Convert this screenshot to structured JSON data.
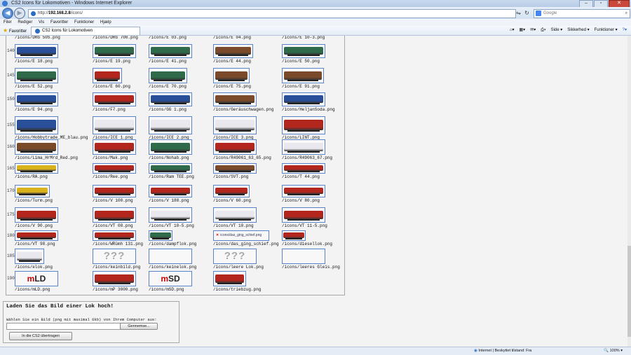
{
  "window": {
    "title": "CS2 Icons für Lokomotiven - Windows Internet Explorer"
  },
  "address": {
    "prefix": "http://",
    "host": "192.168.2.8",
    "path": "/icons/"
  },
  "search": {
    "placeholder": "Google"
  },
  "menu": [
    "Filer",
    "Rediger",
    "Vis",
    "Favoritter",
    "Funktioner",
    "Hjælp"
  ],
  "favorites": {
    "label": "Favoritter",
    "tab_title": "CS2 Icons für Lokomotiven"
  },
  "commandbar": {
    "page": "Side ▾",
    "safety": "Sikkerhed ▾",
    "tools": "Funktioner ▾"
  },
  "grid": {
    "top_labels": [
      "/icons/DRG 50S.png",
      "/icons/DRG 700.png",
      "/icons/E 03.png",
      "/icons/E 04.png",
      "/icons/E 10-3.png"
    ],
    "rows": [
      {
        "num": "140",
        "items": [
          "/icons/E 18.png",
          "/icons/E 19.png",
          "/icons/E 41.png",
          "/icons/E 44.png",
          "/icons/E 50.png"
        ]
      },
      {
        "num": "145",
        "items": [
          "/icons/E 52.png",
          "/icons/E 60.png",
          "/icons/E 70.png",
          "/icons/E 75.png",
          "/icons/E 91.png"
        ]
      },
      {
        "num": "150",
        "items": [
          "/icons/E 94.png",
          "/icons/F7.png",
          "/icons/GG 1.png",
          "/icons/Geräuschwagen.png",
          "/icons/HeljanSoda.png"
        ]
      },
      {
        "num": "155",
        "items": [
          "/icons/Hobbytrade_ME_blau.png",
          "/icons/ICE 1.png",
          "/icons/ICE 2.png",
          "/icons/ICE 3.png",
          "/icons/LINT.png"
        ]
      },
      {
        "num": "160",
        "items": [
          "/icons/Lima_HrMrd_Red.png",
          "/icons/Mak.png",
          "/icons/Nohab.png",
          "/icons/R49061_63_65.png",
          "/icons/R49063_67.png"
        ]
      },
      {
        "num": "165",
        "items": [
          "/icons/RA.png",
          "/icons/Ree.png",
          "/icons/Ram TEE.png",
          "/icons/SVT.png",
          "/icons/T 44.png"
        ]
      },
      {
        "num": "170",
        "items": [
          "/icons/Turm.png",
          "/icons/V 100.png",
          "/icons/V 188.png",
          "/icons/V 60.png",
          "/icons/V 80.png"
        ]
      },
      {
        "num": "175",
        "items": [
          "/icons/V 90.png",
          "/icons/VT 08.png",
          "/icons/VT 10-5.png",
          "/icons/VT 10.png",
          "/icons/VT 11-5.png"
        ]
      },
      {
        "num": "180",
        "items": [
          "/icons/VT 98.png",
          "/icons/WRümh 131.png",
          "/icons/dampflok.png",
          "/icons/das_ging_schief.png",
          "/icons/diesellok.png"
        ]
      },
      {
        "num": "185",
        "items": [
          "/icons/elok.png",
          "/icons/keinbild.png",
          "/icons/keinelok.png",
          "/icons/leere Lok.png",
          "/icons/leeres Gleis.png"
        ]
      },
      {
        "num": "190",
        "items": [
          "/icons/mLD.png",
          "/icons/mP 3000.png",
          "/icons/mSD.png",
          "/icons/triebzug.png"
        ]
      }
    ],
    "placeholders": {
      "question": "???",
      "broken_text": "icons/das_ging_schief.png",
      "mld_m": "m",
      "mld_rest": "LD",
      "msd_m": "m",
      "msd_rest": "SD"
    }
  },
  "upload": {
    "heading": "Laden Sie das Bild einer Lok hoch!",
    "hint": "Wählen Sie ein Bild (png mit maximal 6kb) von Ihrem Computer aus:",
    "browse_label": "Gennemse...",
    "submit_label": "In die CS2 übertragen"
  },
  "status": {
    "zone": "Internet | Beskyttet tilstand: Fra",
    "zoom": "100%"
  },
  "colors": {
    "accent": "#5a82c8",
    "loco_red": "#b3261e",
    "loco_green": "#2f6b4a",
    "loco_brown": "#7a4a2a",
    "loco_blue": "#2a4f9a",
    "loco_white": "#e8e8ee",
    "loco_yellow": "#d9b21c"
  }
}
